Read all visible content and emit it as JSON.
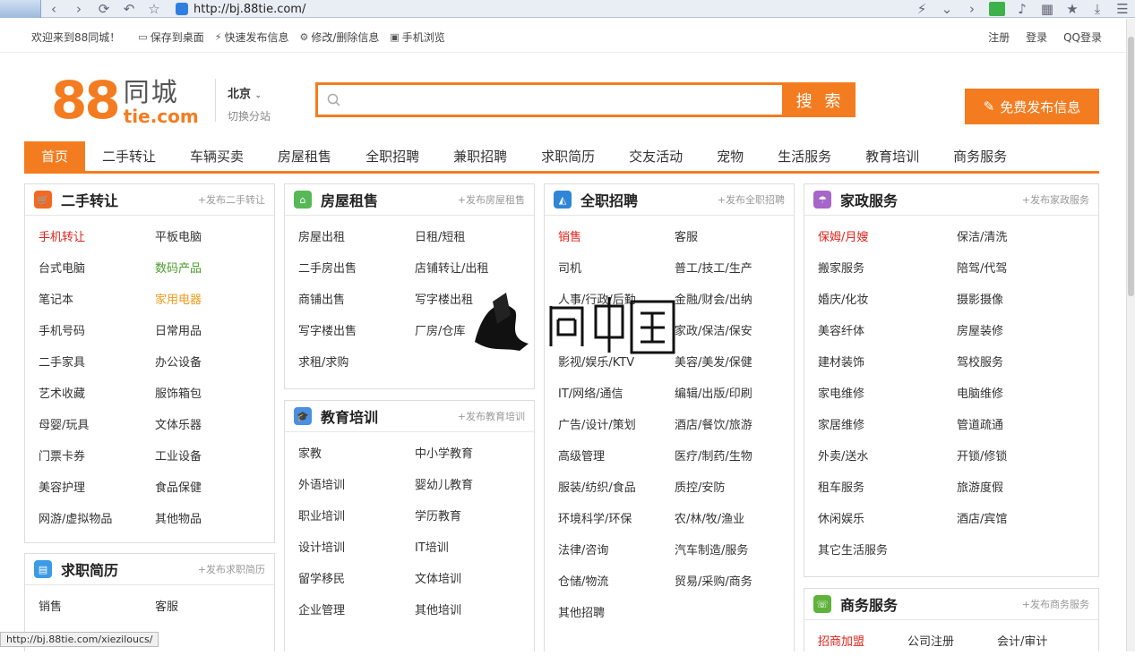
{
  "browser": {
    "url": "http://bj.88tie.com/"
  },
  "topbar": {
    "welcome": "欢迎来到88同城！",
    "links": [
      "保存到桌面",
      "快速发布信息",
      "修改/删除信息",
      "手机浏览"
    ],
    "right": [
      "注册",
      "登录",
      "QQ登录"
    ]
  },
  "header": {
    "logo_num": "88",
    "logo_cn": "同城",
    "logo_en": "tie.com",
    "city": "北京",
    "city_switch": "切换分站",
    "search_btn": "搜 索",
    "post_btn": "免费发布信息"
  },
  "nav": [
    "首页",
    "二手转让",
    "车辆买卖",
    "房屋租售",
    "全职招聘",
    "兼职招聘",
    "求职简历",
    "交友活动",
    "宠物",
    "生活服务",
    "教育培训",
    "商务服务"
  ],
  "panels": {
    "ershou": {
      "title": "二手转让",
      "post": "+发布二手转让",
      "items": [
        "手机转让",
        "平板电脑",
        "台式电脑",
        "数码产品",
        "笔记本",
        "家用电器",
        "手机号码",
        "日常用品",
        "二手家具",
        "办公设备",
        "艺术收藏",
        "服饰箱包",
        "母婴/玩具",
        "文体乐器",
        "门票卡券",
        "工业设备",
        "美容护理",
        "食品保健",
        "网游/虚拟物品",
        "其他物品"
      ]
    },
    "qiuzhi": {
      "title": "求职简历",
      "post": "+发布求职简历",
      "items": [
        "销售",
        "客服"
      ]
    },
    "fangwu": {
      "title": "房屋租售",
      "post": "+发布房屋租售",
      "items": [
        "房屋出租",
        "日租/短租",
        "二手房出售",
        "店铺转让/出租",
        "商铺出售",
        "写字楼出租",
        "写字楼出售",
        "厂房/仓库",
        "求租/求购"
      ]
    },
    "jiaoyu": {
      "title": "教育培训",
      "post": "+发布教育培训",
      "items": [
        "家教",
        "中小学教育",
        "外语培训",
        "婴幼儿教育",
        "职业培训",
        "学历教育",
        "设计培训",
        "IT培训",
        "留学移民",
        "文体培训",
        "企业管理",
        "其他培训"
      ]
    },
    "quanzhi": {
      "title": "全职招聘",
      "post": "+发布全职招聘",
      "items": [
        "销售",
        "客服",
        "司机",
        "普工/技工/生产",
        "人事/行政/后勤",
        "金融/财会/出纳",
        "",
        "家政/保洁/保安",
        "影视/娱乐/KTV",
        "美容/美发/保健",
        "IT/网络/通信",
        "编辑/出版/印刷",
        "广告/设计/策划",
        "酒店/餐饮/旅游",
        "高级管理",
        "医疗/制药/生物",
        "服装/纺织/食品",
        "质控/安防",
        "环境科学/环保",
        "农/林/牧/渔业",
        "法律/咨询",
        "汽车制造/服务",
        "仓储/物流",
        "贸易/采购/商务",
        "其他招聘"
      ]
    },
    "jiazheng": {
      "title": "家政服务",
      "post": "+发布家政服务",
      "items": [
        "保姆/月嫂",
        "保洁/清洗",
        "搬家服务",
        "陪驾/代驾",
        "婚庆/化妆",
        "摄影摄像",
        "美容纤体",
        "房屋装修",
        "建材装饰",
        "驾校服务",
        "家电维修",
        "电脑维修",
        "家居维修",
        "管道疏通",
        "外卖/送水",
        "开锁/修锁",
        "租车服务",
        "旅游度假",
        "休闲娱乐",
        "酒店/宾馆",
        "其它生活服务"
      ]
    },
    "shangwu": {
      "title": "商务服务",
      "post": "+发布商务服务",
      "items": [
        "招商加盟",
        "公司注册",
        "会计/审计"
      ]
    }
  },
  "statusbar": "http://bj.88tie.com/xieziloucs/",
  "colors": {
    "accent": "#f47c20"
  }
}
